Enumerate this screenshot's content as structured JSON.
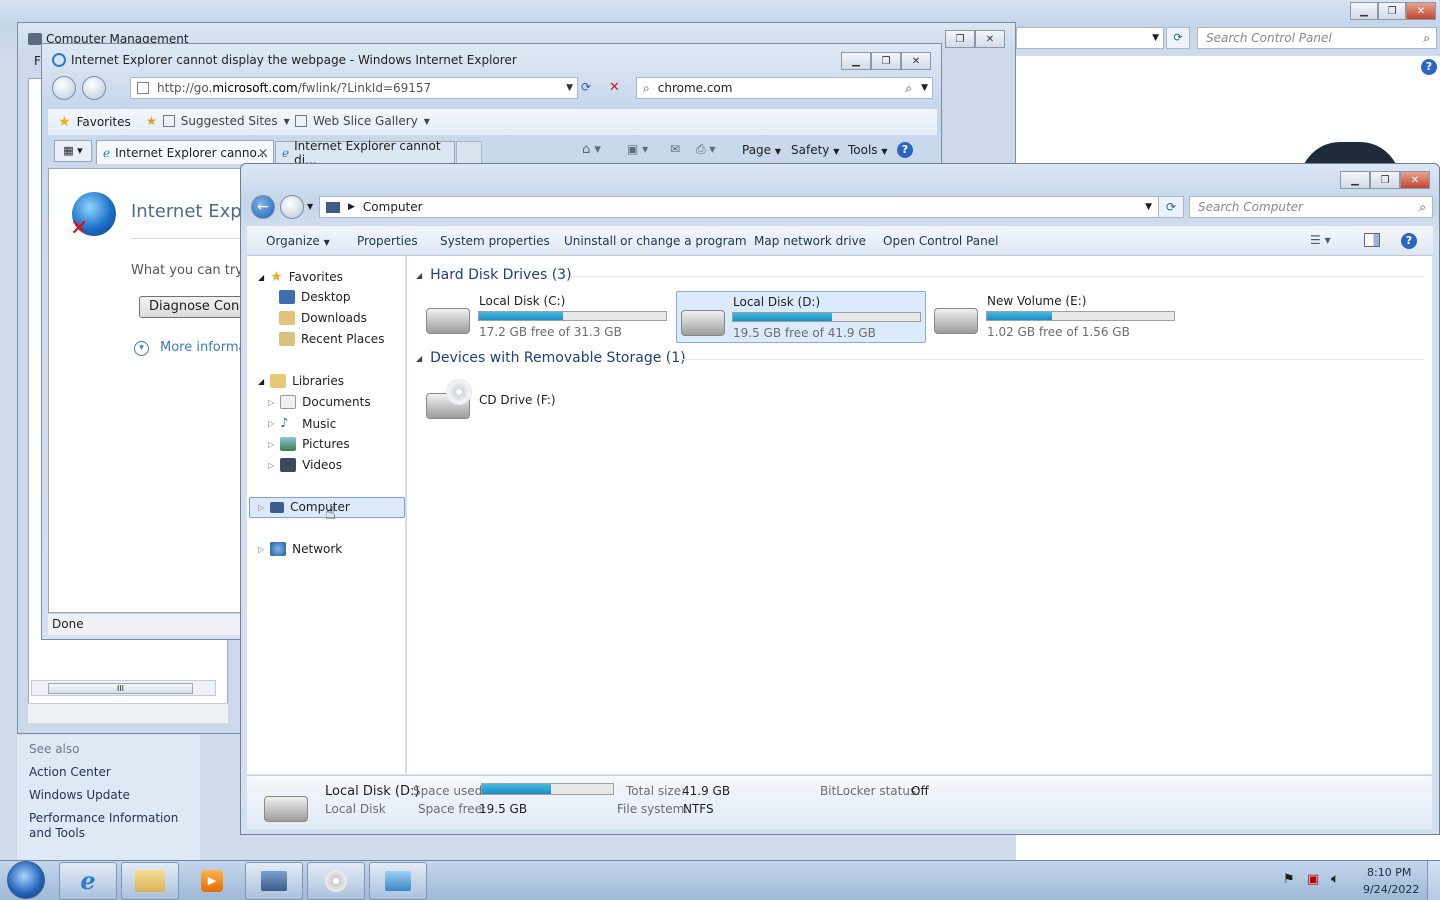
{
  "control_panel": {
    "search_placeholder": "Search Control Panel",
    "see_also_title": "See also",
    "links": [
      "Action Center",
      "Windows Update",
      "Performance Information and Tools"
    ]
  },
  "computer_management": {
    "title": "Computer Management",
    "menu_first": "F"
  },
  "ie": {
    "title": "Internet Explorer cannot display the webpage - Windows Internet Explorer",
    "url_prefix": "http://go.",
    "url_domain": "microsoft.com",
    "url_suffix": "/fwlink/?LinkId=69157",
    "search_value": "chrome.com",
    "favorites_label": "Favorites",
    "suggested_sites": "Suggested Sites",
    "web_slice": "Web Slice Gallery",
    "tab1": "Internet Explorer canno...",
    "tab2": "Internet Explorer cannot di...",
    "cmd_page": "Page",
    "cmd_safety": "Safety",
    "cmd_tools": "Tools",
    "page_heading": "Internet Explo",
    "what_try": "What you can try:",
    "diagnose": "Diagnose Conne",
    "more_info": "More informa",
    "status": "Done",
    "scroll_label": "III"
  },
  "explorer": {
    "breadcrumb": "Computer",
    "search_placeholder": "Search Computer",
    "toolbar": [
      "Organize",
      "Properties",
      "System properties",
      "Uninstall or change a program",
      "Map network drive",
      "Open Control Panel"
    ],
    "nav": {
      "favorites": "Favorites",
      "desktop": "Desktop",
      "downloads": "Downloads",
      "recent": "Recent Places",
      "libraries": "Libraries",
      "documents": "Documents",
      "music": "Music",
      "pictures": "Pictures",
      "videos": "Videos",
      "computer": "Computer",
      "network": "Network"
    },
    "group_hdd": "Hard Disk Drives (3)",
    "group_removable": "Devices with Removable Storage (1)",
    "drives": [
      {
        "name": "Local Disk (C:)",
        "free": "17.2 GB free of 31.3 GB",
        "used_fraction": 0.45
      },
      {
        "name": "Local Disk (D:)",
        "free": "19.5 GB free of 41.9 GB",
        "used_fraction": 0.53
      },
      {
        "name": "New Volume (E:)",
        "free": "1.02 GB free of 1.56 GB",
        "used_fraction": 0.35
      }
    ],
    "cd": "CD Drive (F:)",
    "details": {
      "name": "Local Disk (D:)",
      "type": "Local Disk",
      "space_used_label": "Space used:",
      "space_used_fraction": 0.53,
      "space_free_label": "Space free:",
      "space_free": "19.5 GB",
      "total_label": "Total size:",
      "total": "41.9 GB",
      "fs_label": "File system:",
      "fs": "NTFS",
      "bitlocker_label": "BitLocker status:",
      "bitlocker": "Off"
    }
  },
  "taskbar": {
    "time": "8:10 PM",
    "date": "9/24/2022"
  }
}
